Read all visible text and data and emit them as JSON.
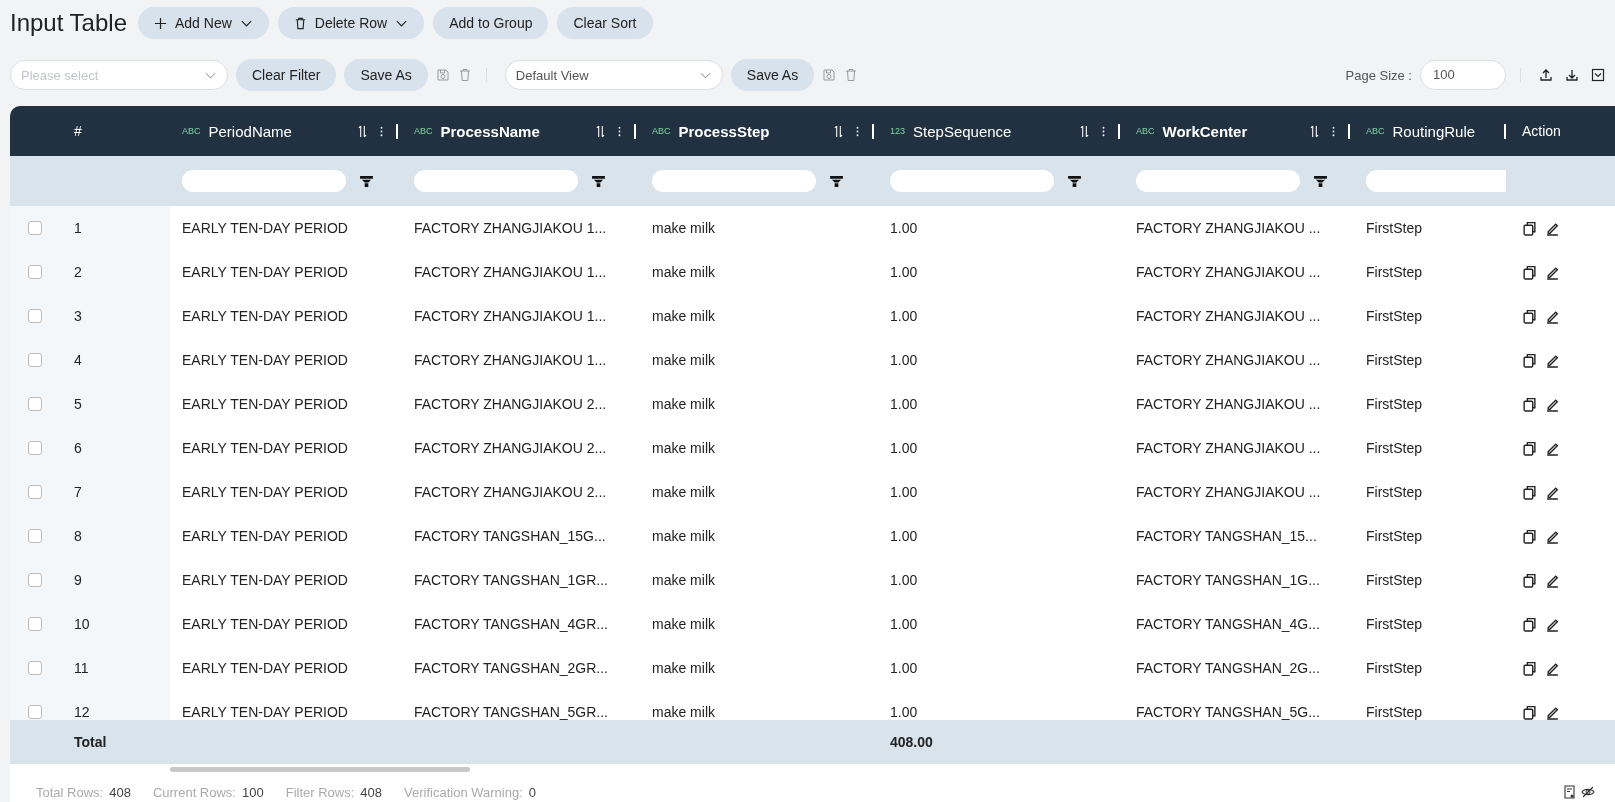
{
  "title": "Input Table",
  "top_buttons": [
    {
      "label": "Add New",
      "kind": "add"
    },
    {
      "label": "Delete Row",
      "kind": "delete"
    },
    {
      "label": "Add to Group",
      "kind": "plain"
    },
    {
      "label": "Clear Sort",
      "kind": "plain"
    }
  ],
  "filter_bar": {
    "filter_select": {
      "placeholder": "Please select"
    },
    "clear_filter": "Clear Filter",
    "save_as_filter": "Save As",
    "view_select": {
      "value": "Default View"
    },
    "save_as_view": "Save As",
    "page_size_label": "Page Size :",
    "page_size": "100"
  },
  "table": {
    "index_header": "#",
    "columns": [
      {
        "type": "ABC",
        "name": "PeriodName",
        "bold": false
      },
      {
        "type": "ABC",
        "name": "ProcessName",
        "bold": true
      },
      {
        "type": "ABC",
        "name": "ProcessStep",
        "bold": true
      },
      {
        "type": "123",
        "name": "StepSequence",
        "bold": false
      },
      {
        "type": "ABC",
        "name": "WorkCenter",
        "bold": true
      },
      {
        "type": "ABC",
        "name": "RoutingRule",
        "bold": false
      }
    ],
    "action_header": "Action",
    "rows": [
      {
        "checked": false,
        "index": "1",
        "cells": [
          "EARLY TEN-DAY PERIOD",
          "FACTORY ZHANGJIAKOU 1...",
          "make milk",
          "1.00",
          "FACTORY ZHANGJIAKOU ...",
          "FirstStep"
        ]
      },
      {
        "checked": false,
        "index": "2",
        "cells": [
          "EARLY TEN-DAY PERIOD",
          "FACTORY ZHANGJIAKOU 1...",
          "make milk",
          "1.00",
          "FACTORY ZHANGJIAKOU ...",
          "FirstStep"
        ]
      },
      {
        "checked": false,
        "index": "3",
        "cells": [
          "EARLY TEN-DAY PERIOD",
          "FACTORY ZHANGJIAKOU 1...",
          "make milk",
          "1.00",
          "FACTORY ZHANGJIAKOU ...",
          "FirstStep"
        ]
      },
      {
        "checked": false,
        "index": "4",
        "cells": [
          "EARLY TEN-DAY PERIOD",
          "FACTORY ZHANGJIAKOU 1...",
          "make milk",
          "1.00",
          "FACTORY ZHANGJIAKOU ...",
          "FirstStep"
        ]
      },
      {
        "checked": false,
        "index": "5",
        "cells": [
          "EARLY TEN-DAY PERIOD",
          "FACTORY ZHANGJIAKOU 2...",
          "make milk",
          "1.00",
          "FACTORY ZHANGJIAKOU ...",
          "FirstStep"
        ]
      },
      {
        "checked": false,
        "index": "6",
        "cells": [
          "EARLY TEN-DAY PERIOD",
          "FACTORY ZHANGJIAKOU 2...",
          "make milk",
          "1.00",
          "FACTORY ZHANGJIAKOU ...",
          "FirstStep"
        ]
      },
      {
        "checked": false,
        "index": "7",
        "cells": [
          "EARLY TEN-DAY PERIOD",
          "FACTORY ZHANGJIAKOU 2...",
          "make milk",
          "1.00",
          "FACTORY ZHANGJIAKOU ...",
          "FirstStep"
        ]
      },
      {
        "checked": false,
        "index": "8",
        "cells": [
          "EARLY TEN-DAY PERIOD",
          "FACTORY TANGSHAN_15G...",
          "make milk",
          "1.00",
          "FACTORY TANGSHAN_15...",
          "FirstStep"
        ]
      },
      {
        "checked": false,
        "index": "9",
        "cells": [
          "EARLY TEN-DAY PERIOD",
          "FACTORY TANGSHAN_1GR...",
          "make milk",
          "1.00",
          "FACTORY TANGSHAN_1G...",
          "FirstStep"
        ]
      },
      {
        "checked": false,
        "index": "10",
        "cells": [
          "EARLY TEN-DAY PERIOD",
          "FACTORY TANGSHAN_4GR...",
          "make milk",
          "1.00",
          "FACTORY TANGSHAN_4G...",
          "FirstStep"
        ]
      },
      {
        "checked": false,
        "index": "11",
        "cells": [
          "EARLY TEN-DAY PERIOD",
          "FACTORY TANGSHAN_2GR...",
          "make milk",
          "1.00",
          "FACTORY TANGSHAN_2G...",
          "FirstStep"
        ]
      },
      {
        "checked": false,
        "index": "12",
        "cells": [
          "EARLY TEN-DAY PERIOD",
          "FACTORY TANGSHAN_5GR...",
          "make milk",
          "1.00",
          "FACTORY TANGSHAN_5G...",
          "FirstStep"
        ]
      }
    ],
    "total": {
      "label": "Total",
      "cells": [
        "",
        "",
        "",
        "408.00",
        "",
        ""
      ]
    }
  },
  "status_bar": [
    {
      "label": "Total Rows:",
      "value": "408"
    },
    {
      "label": "Current Rows:",
      "value": "100"
    },
    {
      "label": "Filter Rows:",
      "value": "408"
    },
    {
      "label": "Verification Warning:",
      "value": "0"
    }
  ]
}
